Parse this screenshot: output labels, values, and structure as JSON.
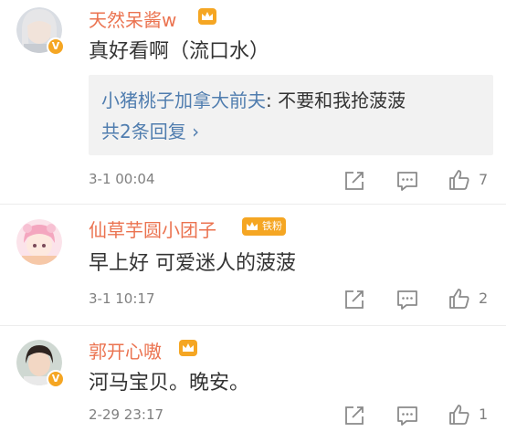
{
  "comments": [
    {
      "username": "天然呆酱w",
      "text": "真好看啊（流口水）",
      "reply": {
        "user": "小猪桃子加拿大前夫",
        "separator": ": ",
        "text": "不要和我抢菠菠",
        "more": "共2条回复 ›"
      },
      "time": "3-1 00:04",
      "likes": "7"
    },
    {
      "username": "仙草芋圆小团子",
      "fan_badge": "铁粉",
      "text": "早上好 可爱迷人的菠菠",
      "time": "3-1 10:17",
      "likes": "2"
    },
    {
      "username": "郭开心嗷",
      "text": "河马宝贝。晚安。",
      "time": "2-29 23:17",
      "likes": "1"
    }
  ],
  "colors": {
    "username": "#eb7350",
    "link": "#507daf",
    "meta": "#808080",
    "badge": "#f5a623"
  },
  "icons": [
    "verified-badge-icon",
    "crown-icon",
    "share-icon",
    "comment-icon",
    "like-icon"
  ]
}
